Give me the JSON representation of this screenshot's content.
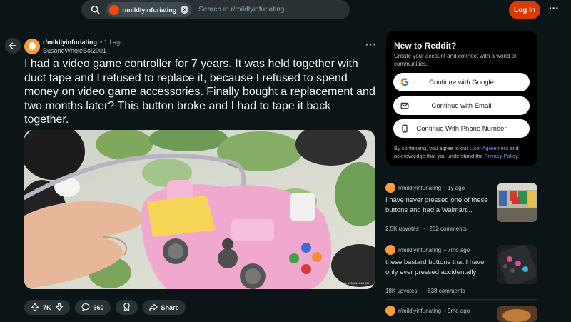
{
  "search": {
    "community_chip": "r/mildlyinfuriating",
    "placeholder": "Search in r/mildlyinfuriating"
  },
  "header": {
    "login_label": "Log In"
  },
  "post": {
    "subreddit": "r/mildlyinfuriating",
    "age": "• 1d ago",
    "author": "BusoneWholeBoi2001",
    "title": "I had a video game controller for 7 years. It was held together with duct tape and I refused to replace it, because I refused to spend money on video game accessories. Finally bought a replacement and two months later? This button broke and I had to tape it back together.",
    "image_caption": "Dec 3, 2024, 9:14 AM",
    "upvotes": "7K",
    "comments": "960",
    "share_label": "Share"
  },
  "sidebar": {
    "new_title": "New to Reddit?",
    "new_desc": "Create your account and connect with a world of communities.",
    "google_label": "Continue with Google",
    "email_label": "Continue with Email",
    "phone_label": "Continue With Phone Number",
    "legal_prefix": "By continuing, you agree to our ",
    "legal_ua": "User Agreement",
    "legal_mid": " and acknowledge that you understand the ",
    "legal_pp": "Privacy Policy",
    "legal_end": "."
  },
  "related": [
    {
      "sub": "r/mildlyinfuriating",
      "age": "• 1y ago",
      "title": "I have never pressed one of these buttons and had a Walmart...",
      "upvotes": "2.5K upvotes",
      "comments": "252 comments"
    },
    {
      "sub": "r/mildlyinfuriating",
      "age": "• 7mo ago",
      "title": "these bastard buttons that I have only ever pressed accidentally",
      "upvotes": "18K upvotes",
      "comments": "638 comments"
    },
    {
      "sub": "r/mildlyinfuriating",
      "age": "• 9mo ago"
    }
  ],
  "colors": {
    "background": "#0b1416",
    "accent_login": "#d93a00",
    "link": "#5c9ce6"
  }
}
